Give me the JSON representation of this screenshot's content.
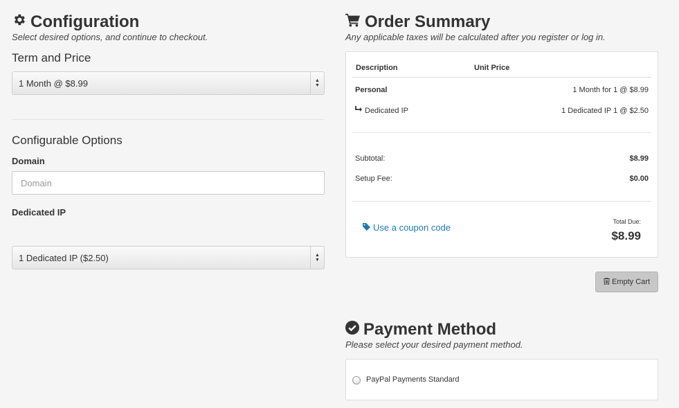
{
  "configuration": {
    "title": "Configuration",
    "subtitle": "Select desired options, and continue to checkout.",
    "term_label": "Term and Price",
    "term_value": "1 Month @ $8.99",
    "options_heading": "Configurable Options",
    "domain_label": "Domain",
    "domain_placeholder": "Domain",
    "domain_value": "",
    "dedicated_ip_label": "Dedicated IP",
    "dedicated_ip_value": "1 Dedicated IP ($2.50)"
  },
  "order_summary": {
    "title": "Order Summary",
    "subtitle": "Any applicable taxes will be calculated after you register or log in.",
    "col_description": "Description",
    "col_unit_price": "Unit Price",
    "items": [
      {
        "name": "Personal",
        "price": "1 Month for 1 @ $8.99"
      },
      {
        "name": "Dedicated IP",
        "price": "1 Dedicated IP 1 @ $2.50"
      }
    ],
    "subtotal_label": "Subtotal:",
    "subtotal_value": "$8.99",
    "setup_fee_label": "Setup Fee:",
    "setup_fee_value": "$0.00",
    "coupon_label": "Use a coupon code",
    "total_due_label": "Total Due:",
    "total_due_value": "$8.99",
    "empty_cart_label": "Empty Cart"
  },
  "payment": {
    "title": "Payment Method",
    "subtitle": "Please select your desired payment method.",
    "options": [
      {
        "label": "PayPal Payments Standard",
        "selected": false
      }
    ]
  },
  "colors": {
    "link": "#1a7ab0",
    "background": "#f5f5f5",
    "button": "#c7c7c7"
  },
  "icons": [
    "gear-icon",
    "cart-icon",
    "arrow-return-icon",
    "tag-icon",
    "trash-icon",
    "check-circle-icon",
    "select-arrows-icon"
  ]
}
